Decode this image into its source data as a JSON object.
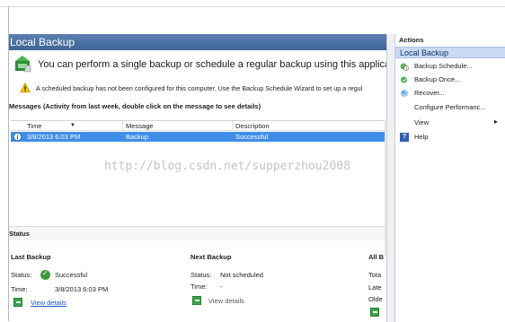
{
  "main": {
    "header_title": "Local Backup",
    "intro_text": "You can perform a single backup or schedule a regular backup using this application.",
    "warning_text": "A scheduled backup has not been configured for this computer. Use the Backup Schedule Wizard to set up a regul",
    "messages_title": "Messages (Activity from last week, double click on the message to see details)",
    "columns": [
      "Time",
      "Message",
      "Description"
    ],
    "rows": [
      {
        "time": "3/8/2013 6:03 PM",
        "message": "Backup",
        "description": "Successful"
      }
    ],
    "status_title": "Status",
    "last_backup": {
      "title": "Last Backup",
      "status_label": "Status:",
      "status_value": "Successful",
      "time_label": "Time:",
      "time_value": "3/8/2013 6:03 PM",
      "details_link": "View details"
    },
    "next_backup": {
      "title": "Next Backup",
      "status_label": "Status:",
      "status_value": "Not scheduled",
      "time_label": "Time:",
      "time_value": "-",
      "details_link": "View details"
    },
    "all_backups": {
      "title": "All B",
      "line1": "Tota",
      "line2": "Late",
      "line3": "Olde"
    }
  },
  "actions": {
    "title": "Actions",
    "section": "Local Backup",
    "items": [
      {
        "label": "Backup Schedule...",
        "icon": "backup-schedule-icon"
      },
      {
        "label": "Backup Once...",
        "icon": "backup-once-icon"
      },
      {
        "label": "Recover...",
        "icon": "recover-icon"
      },
      {
        "label": "Configure Performanc...",
        "icon": "none"
      },
      {
        "label": "View",
        "icon": "none"
      },
      {
        "label": "Help",
        "icon": "help-icon"
      }
    ]
  },
  "watermark": "http://blog.csdn.net/supperzhou2008",
  "colors": {
    "header": "#4a72a6",
    "selection": "#3f8fe8",
    "actions_band": "#c8daf2",
    "success": "#3d9b3d"
  }
}
